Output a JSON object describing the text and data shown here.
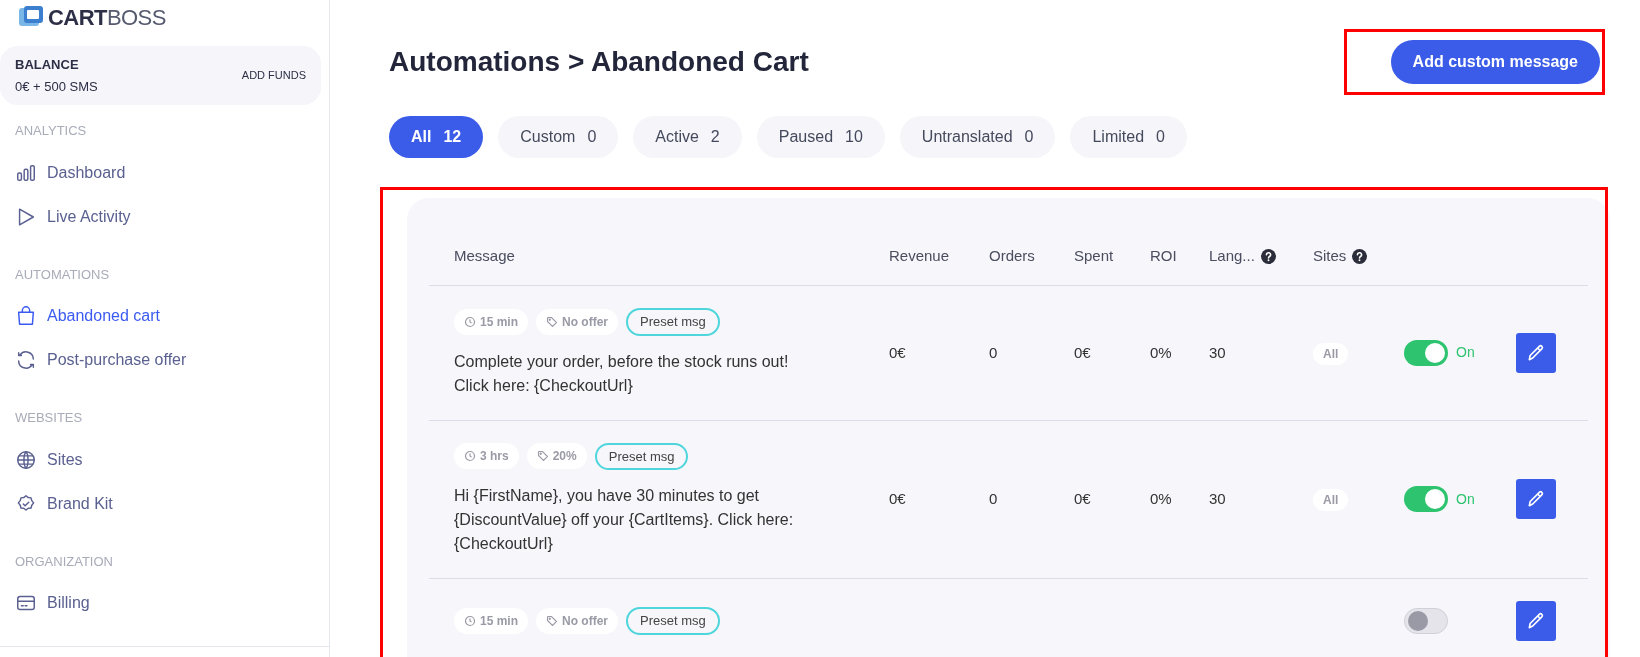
{
  "sidebar": {
    "logo": {
      "prefix": "CART",
      "suffix": "BOSS"
    },
    "balance": {
      "label": "BALANCE",
      "value": "0€ + 500 SMS",
      "action": "ADD FUNDS"
    },
    "sections": [
      {
        "title": "ANALYTICS",
        "items": [
          {
            "kind": "chart",
            "label": "Dashboard",
            "selected": false
          },
          {
            "kind": "play",
            "label": "Live Activity",
            "selected": false
          }
        ]
      },
      {
        "title": "AUTOMATIONS",
        "items": [
          {
            "kind": "bag",
            "label": "Abandoned cart",
            "selected": true
          },
          {
            "kind": "refresh",
            "label": "Post-purchase offer",
            "selected": false
          }
        ]
      },
      {
        "title": "WEBSITES",
        "items": [
          {
            "kind": "globe",
            "label": "Sites",
            "selected": false
          },
          {
            "kind": "badge",
            "label": "Brand Kit",
            "selected": false
          }
        ]
      },
      {
        "title": "ORGANIZATION",
        "items": [
          {
            "kind": "card",
            "label": "Billing",
            "selected": false
          }
        ]
      }
    ]
  },
  "header": {
    "title": "Automations > Abandoned Cart",
    "button": "Add custom message"
  },
  "tabs": [
    {
      "label": "All",
      "count": "12",
      "selected": true
    },
    {
      "label": "Custom",
      "count": "0",
      "selected": false
    },
    {
      "label": "Active",
      "count": "2",
      "selected": false
    },
    {
      "label": "Paused",
      "count": "10",
      "selected": false
    },
    {
      "label": "Untranslated",
      "count": "0",
      "selected": false
    },
    {
      "label": "Limited",
      "count": "0",
      "selected": false
    }
  ],
  "table": {
    "columns": [
      {
        "label": "Message",
        "help": false
      },
      {
        "label": "Revenue",
        "help": false
      },
      {
        "label": "Orders",
        "help": false
      },
      {
        "label": "Spent",
        "help": false
      },
      {
        "label": "ROI",
        "help": false
      },
      {
        "label": "Lang...",
        "help": true
      },
      {
        "label": "Sites",
        "help": true
      }
    ],
    "rows": [
      {
        "delay": "15 min",
        "offer": "No offer",
        "tag": "Preset msg",
        "message": "Complete your order, before the stock runs out! Click here: {CheckoutUrl}",
        "revenue": "0€",
        "orders": "0",
        "spent": "0€",
        "roi": "0%",
        "lang": "30",
        "sites": "All",
        "on": true,
        "status": "On"
      },
      {
        "delay": "3 hrs",
        "offer": "20%",
        "tag": "Preset msg",
        "message": "Hi {FirstName}, you have 30 minutes to get {DiscountValue} off your {CartItems}. Click here: {CheckoutUrl}",
        "revenue": "0€",
        "orders": "0",
        "spent": "0€",
        "roi": "0%",
        "lang": "30",
        "sites": "All",
        "on": true,
        "status": "On"
      },
      {
        "delay": "15 min",
        "offer": "No offer",
        "tag": "Preset msg",
        "on": false
      }
    ]
  }
}
